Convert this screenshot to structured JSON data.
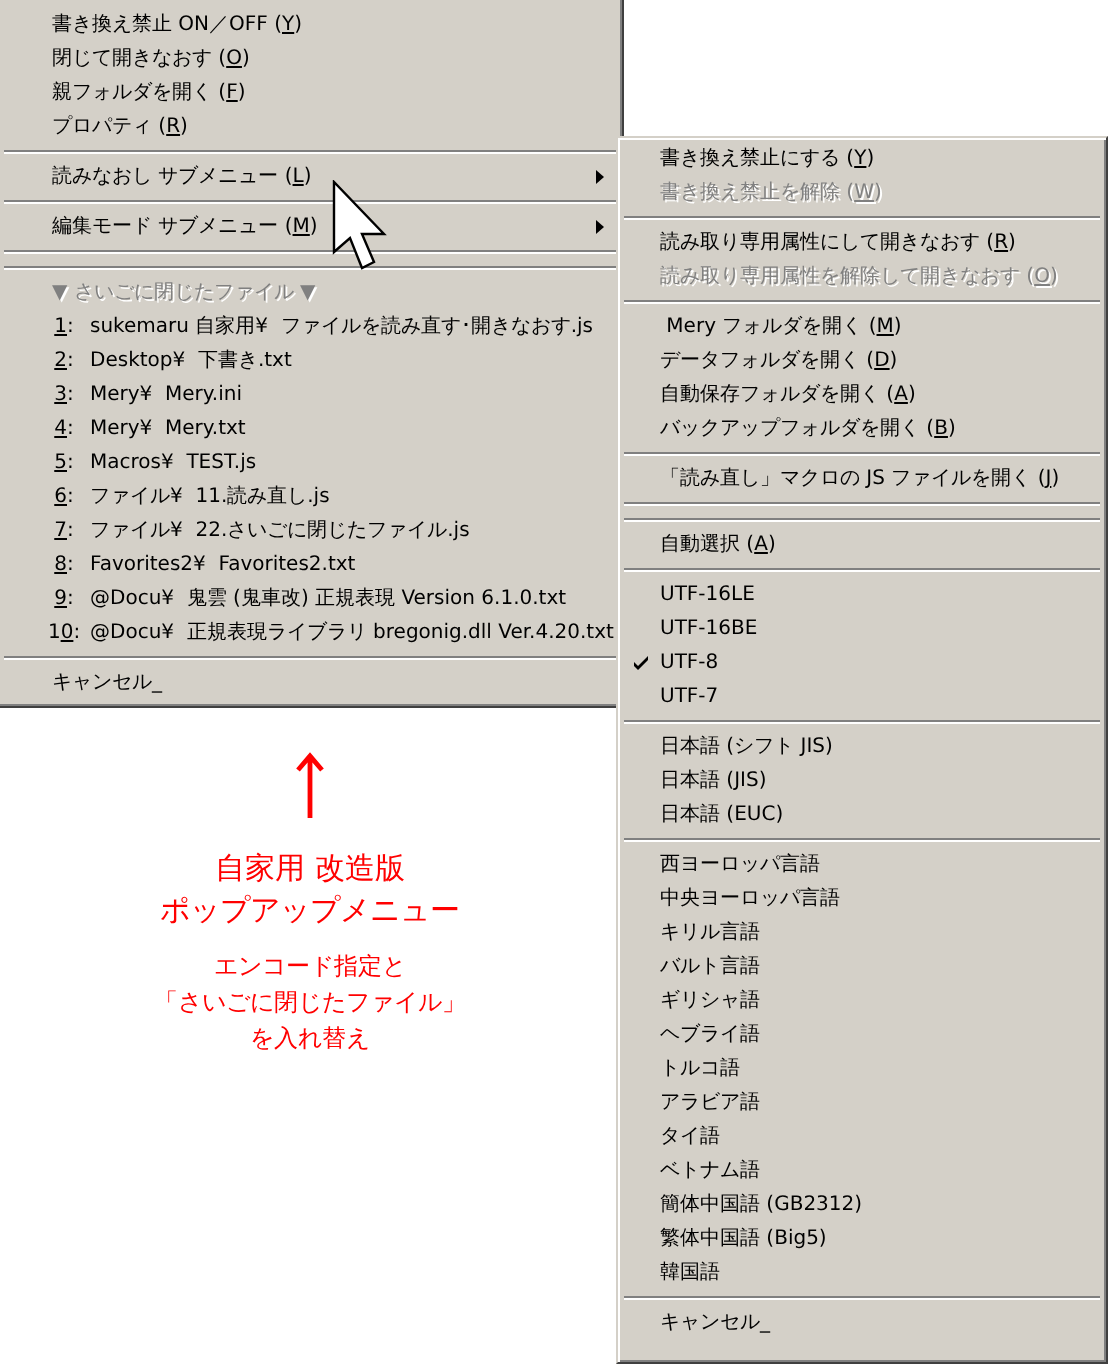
{
  "main_menu": {
    "items": [
      {
        "kind": "item",
        "label": "書き換え禁止 ON／OFF (Y)",
        "disabled": false
      },
      {
        "kind": "item",
        "label": "閉じて開きなおす (O)",
        "disabled": false
      },
      {
        "kind": "item",
        "label": "親フォルダを開く (F)",
        "disabled": false
      },
      {
        "kind": "item",
        "label": "プロパティ (R)",
        "disabled": false
      },
      {
        "kind": "separator"
      },
      {
        "kind": "submenu",
        "label": "読みなおし サブメニュー (L)",
        "disabled": false
      },
      {
        "kind": "separator"
      },
      {
        "kind": "submenu",
        "label": "編集モード サブメニュー (M)",
        "disabled": false
      },
      {
        "kind": "separator"
      },
      {
        "kind": "separator"
      },
      {
        "kind": "item",
        "label": "▼ さいごに閉じたファイル ▼",
        "disabled": true
      },
      {
        "kind": "recent",
        "number": "1:",
        "label": "sukemaru 自家用¥  ファイルを読み直す･開きなおす.js",
        "disabled": false
      },
      {
        "kind": "recent",
        "number": "2:",
        "label": "Desktop¥  下書き.txt",
        "disabled": false
      },
      {
        "kind": "recent",
        "number": "3:",
        "label": "Mery¥  Mery.ini",
        "disabled": false
      },
      {
        "kind": "recent",
        "number": "4:",
        "label": "Mery¥  Mery.txt",
        "disabled": false
      },
      {
        "kind": "recent",
        "number": "5:",
        "label": "Macros¥  TEST.js",
        "disabled": false
      },
      {
        "kind": "recent",
        "number": "6:",
        "label": "ファイル¥  11.読み直し.js",
        "disabled": false
      },
      {
        "kind": "recent",
        "number": "7:",
        "label": "ファイル¥  22.さいごに閉じたファイル.js",
        "disabled": false
      },
      {
        "kind": "recent",
        "number": "8:",
        "label": "Favorites2¥  Favorites2.txt",
        "disabled": false
      },
      {
        "kind": "recent",
        "number": "9:",
        "label": "@Docu¥  鬼雲 (鬼車改) 正規表現 Version 6.1.0.txt",
        "disabled": false
      },
      {
        "kind": "recent",
        "number": "10:",
        "label": "@Docu¥  正規表現ライブラリ bregonig.dll Ver.4.20.txt",
        "disabled": false
      },
      {
        "kind": "separator"
      },
      {
        "kind": "item",
        "label": "キャンセル_",
        "disabled": false
      }
    ]
  },
  "submenu": {
    "items": [
      {
        "kind": "item",
        "label": "書き換え禁止にする (Y)",
        "disabled": false,
        "checked": false
      },
      {
        "kind": "item",
        "label": "書き換え禁止を解除 (W)",
        "disabled": true,
        "checked": false
      },
      {
        "kind": "separator"
      },
      {
        "kind": "item",
        "label": "読み取り専用属性にして開きなおす (R)",
        "disabled": false,
        "checked": false
      },
      {
        "kind": "item",
        "label": "読み取り専用属性を解除して開きなおす (O)",
        "disabled": true,
        "checked": false
      },
      {
        "kind": "separator"
      },
      {
        "kind": "item",
        "label": " Mery フォルダを開く (M)",
        "disabled": false,
        "checked": false
      },
      {
        "kind": "item",
        "label": "データフォルダを開く (D)",
        "disabled": false,
        "checked": false
      },
      {
        "kind": "item",
        "label": "自動保存フォルダを開く (A)",
        "disabled": false,
        "checked": false
      },
      {
        "kind": "item",
        "label": "バックアップフォルダを開く (B)",
        "disabled": false,
        "checked": false
      },
      {
        "kind": "separator"
      },
      {
        "kind": "item",
        "label": "「読み直し」マクロの JS ファイルを開く (J)",
        "disabled": false,
        "checked": false
      },
      {
        "kind": "separator"
      },
      {
        "kind": "separator"
      },
      {
        "kind": "item",
        "label": "自動選択 (A)",
        "disabled": false,
        "checked": false
      },
      {
        "kind": "separator"
      },
      {
        "kind": "item",
        "label": "UTF-16LE",
        "disabled": false,
        "checked": false
      },
      {
        "kind": "item",
        "label": "UTF-16BE",
        "disabled": false,
        "checked": false
      },
      {
        "kind": "item",
        "label": "UTF-8",
        "disabled": false,
        "checked": true
      },
      {
        "kind": "item",
        "label": "UTF-7",
        "disabled": false,
        "checked": false
      },
      {
        "kind": "separator"
      },
      {
        "kind": "item",
        "label": "日本語 (シフト JIS)",
        "disabled": false,
        "checked": false
      },
      {
        "kind": "item",
        "label": "日本語 (JIS)",
        "disabled": false,
        "checked": false
      },
      {
        "kind": "item",
        "label": "日本語 (EUC)",
        "disabled": false,
        "checked": false
      },
      {
        "kind": "separator"
      },
      {
        "kind": "item",
        "label": "西ヨーロッパ言語",
        "disabled": false,
        "checked": false
      },
      {
        "kind": "item",
        "label": "中央ヨーロッパ言語",
        "disabled": false,
        "checked": false
      },
      {
        "kind": "item",
        "label": "キリル言語",
        "disabled": false,
        "checked": false
      },
      {
        "kind": "item",
        "label": "バルト言語",
        "disabled": false,
        "checked": false
      },
      {
        "kind": "item",
        "label": "ギリシャ語",
        "disabled": false,
        "checked": false
      },
      {
        "kind": "item",
        "label": "ヘブライ語",
        "disabled": false,
        "checked": false
      },
      {
        "kind": "item",
        "label": "トルコ語",
        "disabled": false,
        "checked": false
      },
      {
        "kind": "item",
        "label": "アラビア語",
        "disabled": false,
        "checked": false
      },
      {
        "kind": "item",
        "label": "タイ語",
        "disabled": false,
        "checked": false
      },
      {
        "kind": "item",
        "label": "ベトナム語",
        "disabled": false,
        "checked": false
      },
      {
        "kind": "item",
        "label": "簡体中国語 (GB2312)",
        "disabled": false,
        "checked": false
      },
      {
        "kind": "item",
        "label": "繁体中国語 (Big5)",
        "disabled": false,
        "checked": false
      },
      {
        "kind": "item",
        "label": "韓国語",
        "disabled": false,
        "checked": false
      },
      {
        "kind": "separator"
      },
      {
        "kind": "item",
        "label": "キャンセル_",
        "disabled": false,
        "checked": false
      }
    ]
  },
  "annotation": {
    "title_lines": [
      "自家用 改造版",
      "ポップアップメニュー"
    ],
    "note_lines": [
      "エンコード指定と",
      "「さいごに閉じたファイル」",
      "を入れ替え"
    ]
  }
}
